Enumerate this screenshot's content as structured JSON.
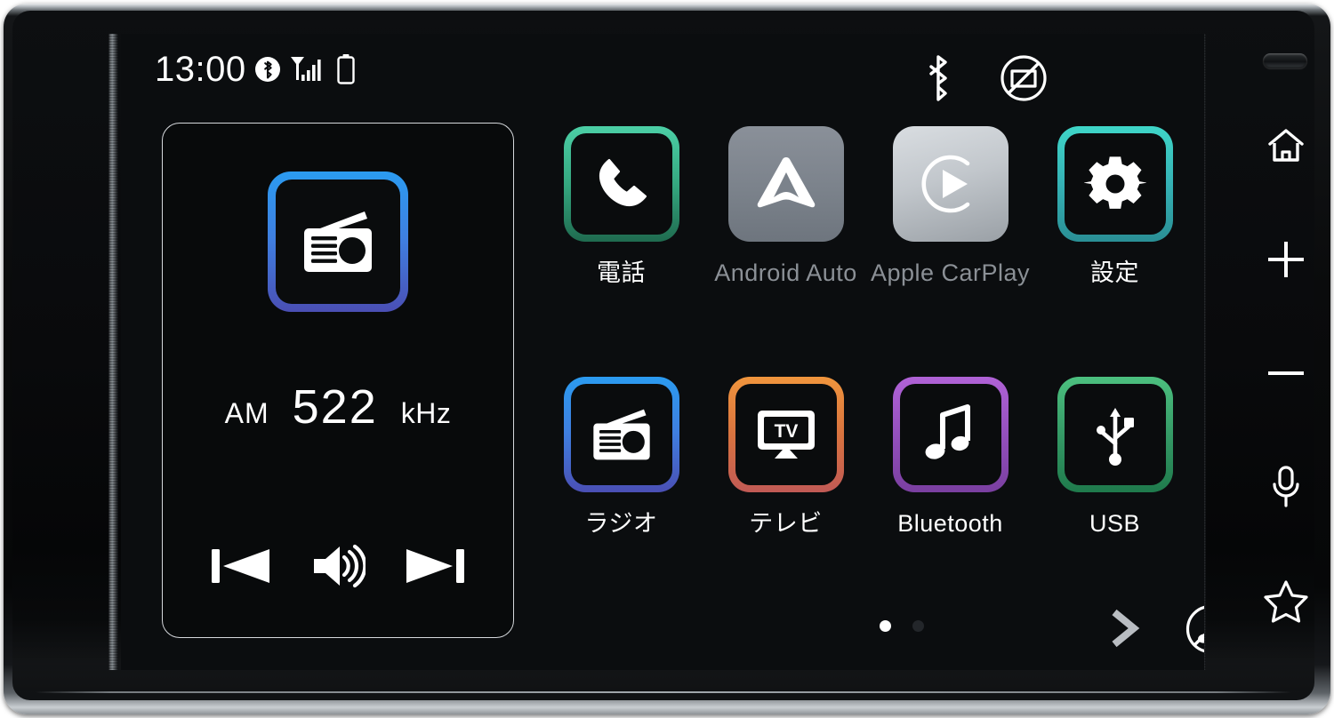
{
  "device": {
    "name": "car-head-unit",
    "screen_label": "home-screen"
  },
  "status_bar": {
    "clock": "13:00",
    "left_icons": [
      {
        "name": "bluetooth-filled-icon",
        "label": "Bluetooth"
      },
      {
        "name": "signal-bars-icon",
        "label": "Signal"
      },
      {
        "name": "battery-icon",
        "label": "Battery"
      }
    ],
    "right_icons": [
      {
        "name": "bluetooth-icon",
        "label": "Bluetooth"
      },
      {
        "name": "no-display-icon",
        "label": "Display Off"
      }
    ]
  },
  "radio_widget": {
    "name": "radio-now-playing",
    "tile_icon": "radio-icon",
    "band": "AM",
    "frequency": "522",
    "unit": "kHz",
    "gradient_from": "#2b9bf0",
    "gradient_to": "#4a4fb4",
    "controls": [
      {
        "name": "previous-track-button",
        "label": "Previous"
      },
      {
        "name": "volume-button",
        "label": "Volume"
      },
      {
        "name": "next-track-button",
        "label": "Next"
      }
    ]
  },
  "apps": [
    {
      "id": "phone",
      "label": "電話",
      "icon": "phone-icon",
      "style": "outline",
      "enabled": true,
      "gradient_from": "#4ccfa6",
      "gradient_to": "#1f6b4f"
    },
    {
      "id": "android-auto",
      "label": "Android Auto",
      "icon": "android-auto-icon",
      "style": "filled",
      "enabled": false,
      "gradient_from": "#8a9099",
      "gradient_to": "#6e757e"
    },
    {
      "id": "apple-carplay",
      "label": "Apple CarPlay",
      "icon": "apple-carplay-icon",
      "style": "filled",
      "enabled": false,
      "gradient_from": "#d3d7db",
      "gradient_to": "#9aa0a6"
    },
    {
      "id": "settings",
      "label": "設定",
      "icon": "gear-icon",
      "style": "outline",
      "enabled": true,
      "gradient_from": "#3fd6c8",
      "gradient_to": "#2a8f95"
    },
    {
      "id": "radio",
      "label": "ラジオ",
      "icon": "radio-icon",
      "style": "outline",
      "enabled": true,
      "gradient_from": "#2b9bf0",
      "gradient_to": "#4a4fb4"
    },
    {
      "id": "tv",
      "label": "テレビ",
      "icon": "tv-icon",
      "style": "outline",
      "enabled": true,
      "gradient_from": "#f0953d",
      "gradient_to": "#c15a55"
    },
    {
      "id": "bluetooth-audio",
      "label": "Bluetooth",
      "icon": "music-note-icon",
      "style": "outline",
      "enabled": true,
      "gradient_from": "#b062d6",
      "gradient_to": "#7a3fa0"
    },
    {
      "id": "usb",
      "label": "USB",
      "icon": "usb-icon",
      "style": "outline",
      "enabled": true,
      "gradient_from": "#4cc07f",
      "gradient_to": "#1f7a4c"
    }
  ],
  "bottom_bar": {
    "pages": 2,
    "current_page": 1,
    "next_page": {
      "name": "next-page-button",
      "icon": "chevron-right-icon"
    },
    "mute": {
      "name": "mute-button",
      "icon": "mute-music-icon"
    }
  },
  "hardware_buttons": [
    {
      "id": "home",
      "icon": "home-icon",
      "label": "Home"
    },
    {
      "id": "volume-up",
      "icon": "plus-icon",
      "label": "Volume Up"
    },
    {
      "id": "volume-down",
      "icon": "minus-icon",
      "label": "Volume Down"
    },
    {
      "id": "voice",
      "icon": "microphone-icon",
      "label": "Voice"
    },
    {
      "id": "favorite",
      "icon": "star-icon",
      "label": "Favorite"
    }
  ]
}
